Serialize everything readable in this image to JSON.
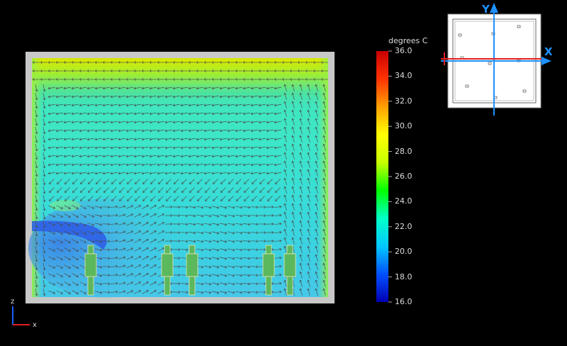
{
  "colorbar": {
    "title": "degrees C",
    "ticks": [
      "36.0",
      "34.0",
      "32.0",
      "30.0",
      "28.0",
      "26.0",
      "24.0",
      "22.0",
      "20.0",
      "18.0",
      "16.0"
    ],
    "min": 16.0,
    "max": 36.0,
    "colors": [
      "#0000b4",
      "#0050ff",
      "#00c8ff",
      "#00ffc8",
      "#00ff00",
      "#c8ff00",
      "#ffff00",
      "#ffa000",
      "#ff3200",
      "#c80000"
    ]
  },
  "main_axes": {
    "vertical": "z",
    "horizontal": "x"
  },
  "plan_view": {
    "y_label": "Y",
    "x_label": "X"
  },
  "colors": {
    "background": "#000000",
    "wall": "#c8c8c8",
    "rack_fill": "#5cb85c",
    "rack_outline": "#e6e6b4",
    "arrow": "#4a4a4a",
    "axis_blue": "#1e90ff",
    "axis_red": "#e02020"
  }
}
